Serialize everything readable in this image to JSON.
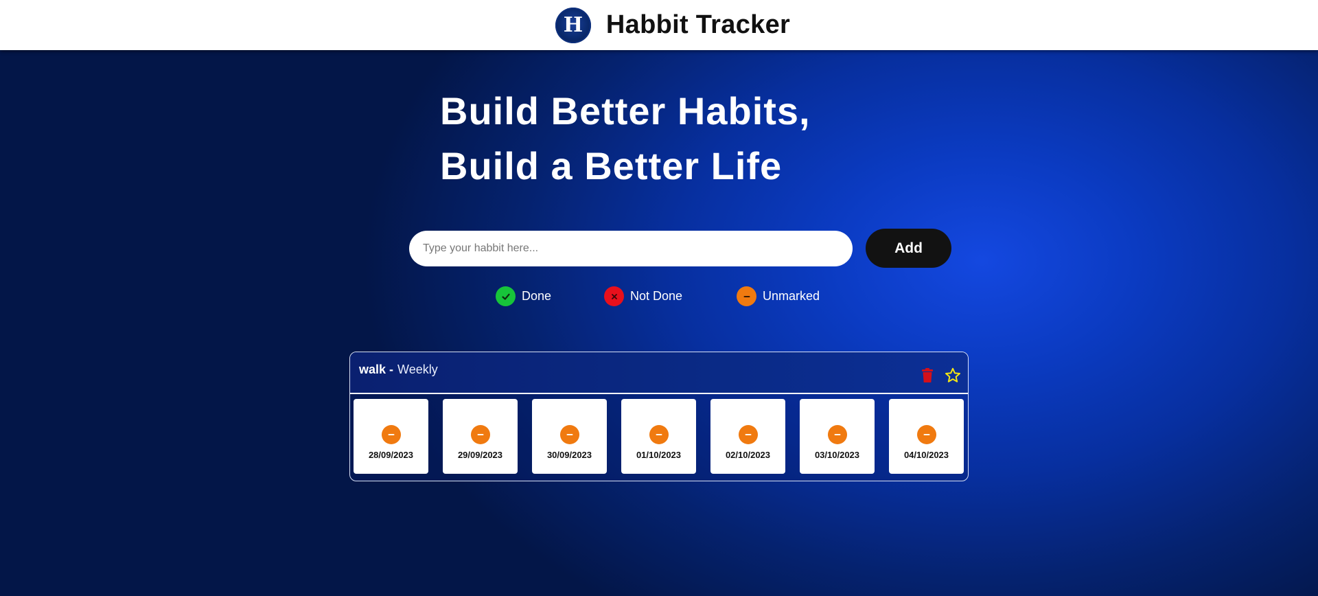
{
  "app": {
    "logo_letter": "H",
    "title": "Habbit Tracker"
  },
  "hero": {
    "line1": "Build Better Habits,",
    "line2": "Build a Better Life"
  },
  "form": {
    "placeholder": "Type your habbit here...",
    "add_label": "Add"
  },
  "legend": [
    {
      "label": "Done",
      "color": "#17c43a",
      "icon": "check-icon"
    },
    {
      "label": "Not Done",
      "color": "#e8101c",
      "icon": "x-icon"
    },
    {
      "label": "Unmarked",
      "color": "#f07a10",
      "icon": "minus-icon"
    }
  ],
  "habits": [
    {
      "name": "walk -",
      "frequency": "Weekly",
      "actions": [
        "trash-icon",
        "star-icon"
      ],
      "days": [
        {
          "date": "28/09/2023",
          "status": "unmarked"
        },
        {
          "date": "29/09/2023",
          "status": "unmarked"
        },
        {
          "date": "30/09/2023",
          "status": "unmarked"
        },
        {
          "date": "01/10/2023",
          "status": "unmarked"
        },
        {
          "date": "02/10/2023",
          "status": "unmarked"
        },
        {
          "date": "03/10/2023",
          "status": "unmarked"
        },
        {
          "date": "04/10/2023",
          "status": "unmarked"
        }
      ]
    }
  ],
  "colors": {
    "background": "#0b3bc2",
    "nav_bg": "#ffffff",
    "button_bg": "#121212",
    "trash": "#d4101a",
    "star": "#f5e614"
  }
}
